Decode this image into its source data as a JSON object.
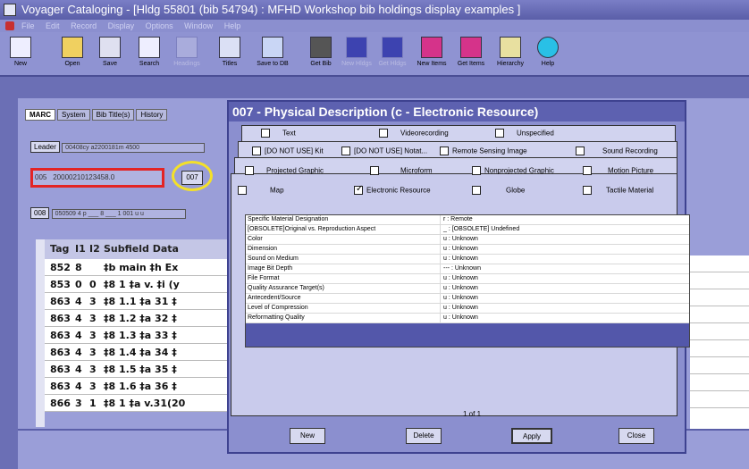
{
  "window": {
    "title": "Voyager Cataloging - [Hldg 55801 (bib 54794) : MFHD Workshop bib holdings display examples ]"
  },
  "menu": [
    "File",
    "Edit",
    "Record",
    "Display",
    "Options",
    "Window",
    "Help"
  ],
  "toolbar": [
    {
      "label": "New",
      "enabled": true
    },
    {
      "label": "Open",
      "enabled": true
    },
    {
      "label": "Save",
      "enabled": true
    },
    {
      "label": "Search",
      "enabled": true
    },
    {
      "label": "Headings",
      "enabled": false
    },
    {
      "label": "Titles",
      "enabled": true
    },
    {
      "label": "Save to DB",
      "enabled": true
    },
    {
      "label": "Get Bib",
      "enabled": true
    },
    {
      "label": "New Hldgs",
      "enabled": false
    },
    {
      "label": "Get Hldgs",
      "enabled": false
    },
    {
      "label": "New Items",
      "enabled": true
    },
    {
      "label": "Get Items",
      "enabled": true
    },
    {
      "label": "Hierarchy",
      "enabled": true
    },
    {
      "label": "Help",
      "enabled": true
    }
  ],
  "record_tabs": [
    "MARC",
    "System",
    "Bib Title(s)",
    "History"
  ],
  "leader": {
    "label": "Leader",
    "value": "00408cy a2200181m 4500"
  },
  "field_005": {
    "tag": "005",
    "value": "20000210123458.0"
  },
  "button_007": "007",
  "field_008": {
    "tag": "008",
    "value": "050509 4 p ___ 8 ___ 1 001 u u"
  },
  "table": {
    "headers": [
      "Tag",
      "I1",
      "I2",
      "Subfield Data"
    ],
    "rows": [
      [
        "852",
        "8",
        "",
        "‡b main ‡h Ex"
      ],
      [
        "853",
        "0",
        "0",
        "‡8 1 ‡a v. ‡i (y"
      ],
      [
        "863",
        "4",
        "3",
        "‡8 1.1 ‡a 31 ‡"
      ],
      [
        "863",
        "4",
        "3",
        "‡8 1.2 ‡a 32 ‡"
      ],
      [
        "863",
        "4",
        "3",
        "‡8 1.3 ‡a 33 ‡"
      ],
      [
        "863",
        "4",
        "3",
        "‡8 1.4 ‡a 34 ‡"
      ],
      [
        "863",
        "4",
        "3",
        "‡8 1.5 ‡a 35 ‡"
      ],
      [
        "863",
        "4",
        "3",
        "‡8 1.6 ‡a 36 ‡"
      ],
      [
        "866",
        "3",
        "1",
        "‡8 1 ‡a v.31(20"
      ]
    ]
  },
  "dialog": {
    "title": "007 - Physical Description (c - Electronic Resource)",
    "categories_row1": [
      "Text",
      "Videorecording",
      "Unspecified"
    ],
    "categories_row2": [
      "[DO NOT USE] Kit",
      "[DO NOT USE] Notat...",
      "Remote Sensing Image",
      "Sound Recording"
    ],
    "categories_row3": [
      "Projected Graphic",
      "Microform",
      "Nonprojected Graphic",
      "Motion Picture"
    ],
    "categories_row4": [
      {
        "label": "Map",
        "checked": false
      },
      {
        "label": "Electronic Resource",
        "checked": true
      },
      {
        "label": "Globe",
        "checked": false
      },
      {
        "label": "Tactile Material",
        "checked": false
      }
    ],
    "properties": [
      {
        "name": "Specific Material Designation",
        "value": "r : Remote"
      },
      {
        "name": "[OBSOLETE]Original vs. Reproduction Aspect",
        "value": "_ : [OBSOLETE] Undefined"
      },
      {
        "name": "Color",
        "value": "u : Unknown"
      },
      {
        "name": "Dimension",
        "value": "u : Unknown"
      },
      {
        "name": "Sound on Medium",
        "value": "u : Unknown"
      },
      {
        "name": "Image Bit Depth",
        "value": "--- : Unknown"
      },
      {
        "name": "File Format",
        "value": "u : Unknown"
      },
      {
        "name": "Quality Assurance Target(s)",
        "value": "u : Unknown"
      },
      {
        "name": "Antecedent/Source",
        "value": "u : Unknown"
      },
      {
        "name": "Level of Compression",
        "value": "u : Unknown"
      },
      {
        "name": "Reformatting Quality",
        "value": "u : Unknown"
      }
    ],
    "pager": "1 of 1",
    "buttons": {
      "new": "New",
      "delete": "Delete",
      "apply": "Apply",
      "close": "Close"
    }
  }
}
